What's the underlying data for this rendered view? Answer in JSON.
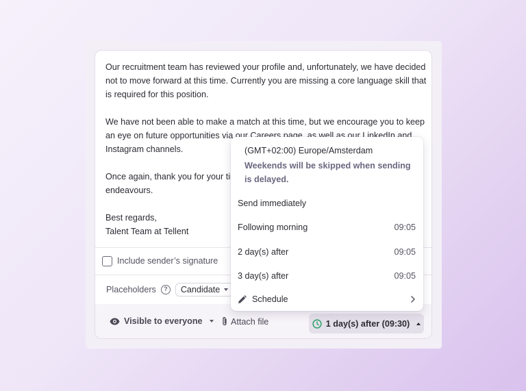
{
  "message": {
    "paragraphs": [
      "Our recruitment team has reviewed your profile and, unfortunately, we have decided not to move forward at this time. Currently you are missing a core language skill that is required for this position.",
      "We have not been able to make a match at this time, but we encourage you to keep an eye on future opportunities via our Careers page, as well as our LinkedIn and Instagram channels.",
      "Once again, thank you for your time and we wish you all the best in your future endeavours."
    ],
    "closing": "Best regards,",
    "signature_name": "Talent Team at Tellent"
  },
  "signature_option": {
    "label": "Include sender’s signature",
    "checked": false
  },
  "placeholders": {
    "label": "Placeholders",
    "help_icon": "question-circle-icon",
    "chip_label": "Candidate"
  },
  "footer": {
    "visibility_label": "Visible to everyone",
    "visibility_icon": "eye-icon",
    "attach_label": "Attach file",
    "attach_icon": "paperclip-icon",
    "send_label": "1 day(s) after (09:30)",
    "send_icon": "clock-icon",
    "send_icon_color": "#2fa36b"
  },
  "schedule_menu": {
    "timezone": "(GMT+02:00) Europe/Amsterdam",
    "note": "Weekends will be skipped when sending is delayed.",
    "items": [
      {
        "label": "Send immediately",
        "time": ""
      },
      {
        "label": "Following morning",
        "time": "09:05"
      },
      {
        "label": "2 day(s) after",
        "time": "09:05"
      },
      {
        "label": "3 day(s) after",
        "time": "09:05"
      }
    ],
    "custom_label": "Schedule"
  }
}
